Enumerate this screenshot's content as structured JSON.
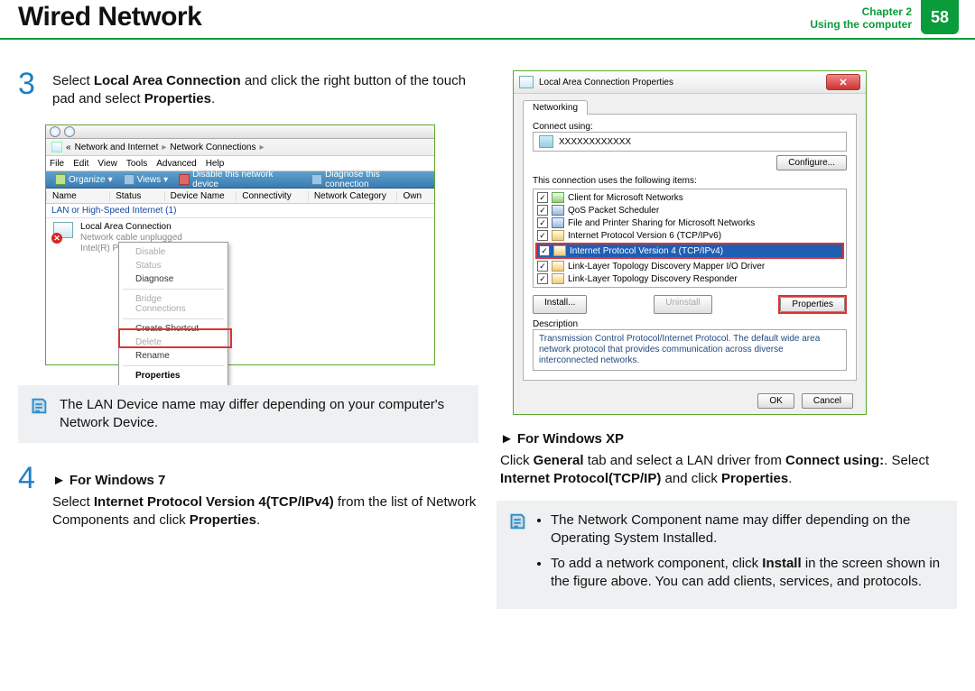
{
  "header": {
    "title": "Wired Network",
    "chapter_line1": "Chapter 2",
    "chapter_line2": "Using the computer",
    "page": "58"
  },
  "step3": {
    "num": "3",
    "text_a": "Select ",
    "bold_a": "Local Area Connection",
    "text_b": " and click the right button of the touch pad and select ",
    "bold_b": "Properties",
    "text_c": "."
  },
  "shot1": {
    "addr_a": "Network and Internet",
    "addr_b": "Network Connections",
    "menu": [
      "File",
      "Edit",
      "View",
      "Tools",
      "Advanced",
      "Help"
    ],
    "tb_organize": "Organize",
    "tb_views": "Views",
    "tb_disable": "Disable this network device",
    "tb_diagnose": "Diagnose this connection",
    "cols": [
      "Name",
      "Status",
      "Device Name",
      "Connectivity",
      "Network Category",
      "Own"
    ],
    "lan_group": "LAN or High-Speed Internet (1)",
    "conn_name": "Local Area Connection",
    "conn_state": "Network cable unplugged",
    "conn_dev": "Intel(R) PRO/100",
    "ctx": {
      "disable": "Disable",
      "status": "Status",
      "diagnose": "Diagnose",
      "bridge": "Bridge Connections",
      "shortcut": "Create Shortcut",
      "delete": "Delete",
      "rename": "Rename",
      "properties": "Properties"
    }
  },
  "note1": "The LAN Device name may differ depending on your computer's Network Device.",
  "step4": {
    "num": "4",
    "head": "For Windows 7",
    "text_a": "Select ",
    "bold_a": "Internet Protocol Version 4(TCP/IPv4)",
    "text_b": " from the list of Network Components and click ",
    "bold_b": "Properties",
    "text_c": "."
  },
  "shot2": {
    "title": "Local Area Connection Properties",
    "close": "✕",
    "tab": "Networking",
    "connect_label": "Connect using:",
    "device": "XXXXXXXXXXXX",
    "configure": "Configure...",
    "uses": "This connection uses the following items:",
    "items": [
      "Client for Microsoft Networks",
      "QoS Packet Scheduler",
      "File and Printer Sharing for Microsoft Networks",
      "Internet Protocol Version 6 (TCP/IPv6)",
      "Internet Protocol Version 4 (TCP/IPv4)",
      "Link-Layer Topology Discovery Mapper I/O Driver",
      "Link-Layer Topology Discovery Responder"
    ],
    "install": "Install...",
    "uninstall": "Uninstall",
    "properties": "Properties",
    "desc_label": "Description",
    "desc_text": "Transmission Control Protocol/Internet Protocol. The default wide area network protocol that provides communication across diverse interconnected networks.",
    "ok": "OK",
    "cancel": "Cancel"
  },
  "xp": {
    "head": "For Windows XP",
    "t1": "Click ",
    "b1": "General",
    "t2": " tab and select a LAN driver from ",
    "b2": "Connect using:",
    "t3": ". Select ",
    "b3": "Internet Protocol(TCP/IP)",
    "t4": " and click ",
    "b4": "Properties",
    "t5": "."
  },
  "note2": {
    "li1": "The Network Component name may differ depending on the Operating System Installed.",
    "li2a": "To add a network component, click ",
    "li2b": "Install",
    "li2c": " in the screen shown in the figure above. You can add clients, services, and protocols."
  }
}
